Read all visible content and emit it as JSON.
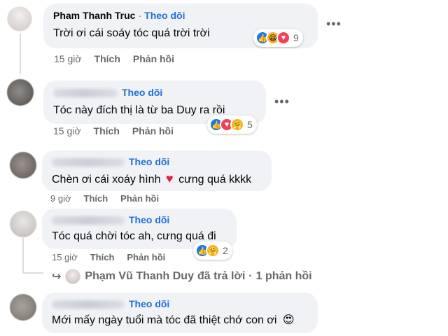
{
  "comments": [
    {
      "name": "Pham Thanh Truc",
      "follow": "Theo dõi",
      "separator": "·",
      "text": "Trời ơi cái soáy tóc quá trời trời",
      "time": "15 giờ",
      "like": "Thích",
      "reply": "Phản hồi",
      "reaction_count": "9",
      "reactions": [
        "like-icon",
        "haha-icon",
        "love-icon"
      ]
    },
    {
      "follow": "Theo dõi",
      "text": "Tóc này đích thị là từ ba Duy ra rồi",
      "time": "15 giờ",
      "like": "Thích",
      "reply": "Phản hồi",
      "reaction_count": "5",
      "reactions": [
        "like-icon",
        "love-icon",
        "care-icon"
      ]
    },
    {
      "follow": "Theo dõi",
      "text_before": "Chèn ơi cái xoáy hình",
      "heart": "♥",
      "text_after": "cưng quá kkkk",
      "time": "9 giờ",
      "like": "Thích",
      "reply": "Phản hồi"
    },
    {
      "follow": "Theo dõi",
      "text": "Tóc quá chời tóc ah, cưng quá đi",
      "time": "15 giờ",
      "like": "Thích",
      "reply": "Phản hồi",
      "reaction_count": "2",
      "reactions": [
        "like-icon",
        "care-icon"
      ]
    },
    {
      "follow": "Theo dõi",
      "text": "Mới mấy ngày tuổi mà tóc đã thiệt chớ con ơi",
      "emoji": "😍"
    }
  ],
  "reply_summary": {
    "arrow": "↪",
    "author": "Phạm Vũ Thanh Duy",
    "action": "đã trả lời",
    "separator": "·",
    "count": "1 phản hồi"
  },
  "more_label": "•••",
  "colors": {
    "follow": "#216fdb",
    "bubble": "#f0f2f5",
    "meta": "#65676b",
    "like": "#1877f2",
    "love": "#f33e58",
    "haha": "#f7b125"
  }
}
